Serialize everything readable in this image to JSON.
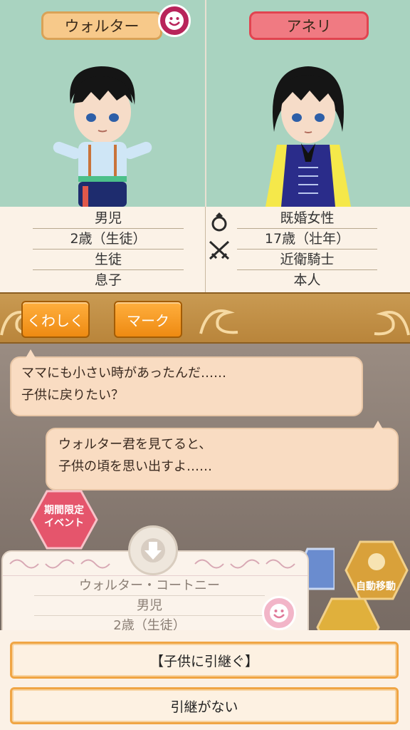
{
  "left_character": {
    "name": "ウォルター",
    "mood_icon": "smile-icon",
    "profile": [
      "男児",
      "2歳（生徒）",
      "生徒",
      "息子"
    ]
  },
  "right_character": {
    "name": "アネリ",
    "profile": [
      "既婚女性",
      "17歳（壮年）",
      "近衛騎士",
      "本人"
    ]
  },
  "relation_icons": [
    "ring-icon",
    "swords-icon"
  ],
  "buttons": {
    "details": "くわしく",
    "mark": "マーク"
  },
  "dialogue": [
    {
      "speaker": "left",
      "lines": [
        "ママにも小さい時があったんだ……",
        "子供に戻りたい？"
      ]
    },
    {
      "speaker": "right",
      "lines": [
        "ウォルター君を見てると、",
        "子供の頃を思い出すよ……"
      ]
    }
  ],
  "event_badge": [
    "期間限定",
    "イベント"
  ],
  "auto_move_label": "自動移動",
  "card": {
    "rows": [
      "ウォルター・コートニー",
      "男児",
      "2歳（生徒）"
    ]
  },
  "choices": [
    "【子供に引継ぐ】",
    "引継がない"
  ],
  "colors": {
    "portrait_bg": "#a9d3c0",
    "left_name_bg": "#f7c98a",
    "right_name_bg": "#f07a82",
    "button_orange": "#ee8a12",
    "bubble_bg": "#f9dcc2"
  }
}
